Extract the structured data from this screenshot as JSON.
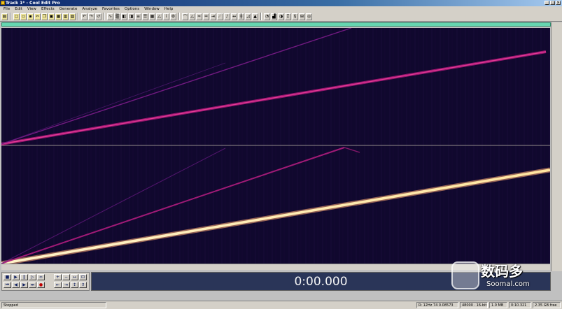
{
  "window": {
    "title": "Track 1* - Cool Edit Pro",
    "buttons": [
      "_",
      "□",
      "×"
    ]
  },
  "menu": [
    "File",
    "Edit",
    "View",
    "Effects",
    "Generate",
    "Analyze",
    "Favorites",
    "Options",
    "Window",
    "Help"
  ],
  "time_display": "0:00.000",
  "status": {
    "left": "Stopped",
    "fields": [
      "R: 12Hz  74  0.08573",
      "48000 · 16-bit · Stereo",
      "1.0 MB",
      "0:10.321",
      "2.35 GB free"
    ]
  },
  "watermark": {
    "main": "数码多",
    "sub": "Soomal.com"
  },
  "colors": {
    "spectrum_bg": "#10082e",
    "overview": "#65d6b0",
    "time_bg": "#2a3558"
  }
}
